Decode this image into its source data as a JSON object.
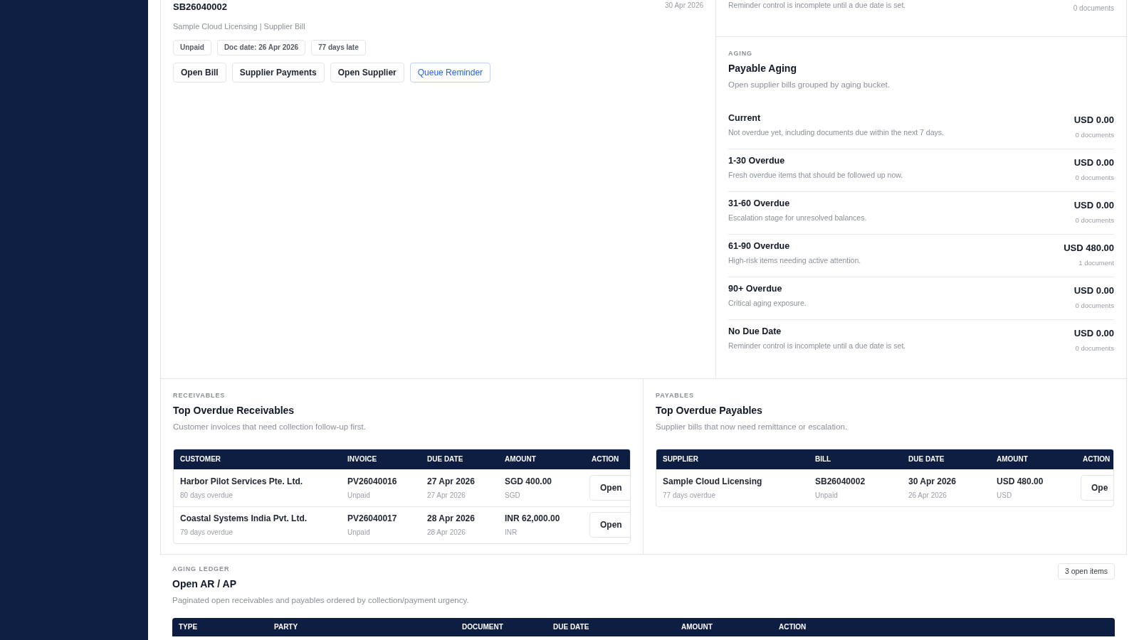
{
  "bill_card": {
    "document": "SB26040002",
    "date": "30 Apr 2026",
    "subtitle": "Sample Cloud Licensing | Supplier Bill",
    "chips": [
      "Unpaid",
      "Doc date: 26 Apr 2026",
      "77 days late"
    ],
    "actions": [
      {
        "label": "Open Bill",
        "kind": "default"
      },
      {
        "label": "Supplier Payments",
        "kind": "default"
      },
      {
        "label": "Open Supplier",
        "kind": "default"
      },
      {
        "label": "Queue Reminder",
        "kind": "primary"
      }
    ]
  },
  "previous_aging_tail": {
    "description": "Reminder control is incomplete until a due date is set.",
    "count": "0 documents"
  },
  "payable_aging": {
    "eyebrow": "AGING",
    "title": "Payable Aging",
    "description": "Open supplier bills grouped by aging bucket.",
    "buckets": [
      {
        "name": "Current",
        "description": "Not overdue yet, including documents due within the next 7 days.",
        "amount": "USD 0.00",
        "count": "0 documents"
      },
      {
        "name": "1-30 Overdue",
        "description": "Fresh overdue items that should be followed up now.",
        "amount": "USD 0.00",
        "count": "0 documents"
      },
      {
        "name": "31-60 Overdue",
        "description": "Escalation stage for unresolved balances.",
        "amount": "USD 0.00",
        "count": "0 documents"
      },
      {
        "name": "61-90 Overdue",
        "description": "High-risk items needing active attention.",
        "amount": "USD 480.00",
        "count": "1 document"
      },
      {
        "name": "90+ Overdue",
        "description": "Critical aging exposure.",
        "amount": "USD 0.00",
        "count": "0 documents"
      },
      {
        "name": "No Due Date",
        "description": "Reminder control is incomplete until a due date is set.",
        "amount": "USD 0.00",
        "count": "0 documents"
      }
    ]
  },
  "receivables": {
    "eyebrow": "RECEIVABLES",
    "title": "Top Overdue Receivables",
    "description": "Customer invoices that need collection follow-up first.",
    "columns": [
      "CUSTOMER",
      "INVOICE",
      "DUE DATE",
      "AMOUNT",
      "ACTION"
    ],
    "rows": [
      {
        "party": "Harbor Pilot Services Pte. Ltd.",
        "overdue": "80 days overdue",
        "document": "PV26040016",
        "status": "Unpaid",
        "due_date": "27 Apr 2026",
        "doc_date": "27 Apr 2026",
        "amount": "SGD 400.00",
        "currency": "SGD",
        "action": "Open"
      },
      {
        "party": "Coastal Systems India Pvt. Ltd.",
        "overdue": "79 days overdue",
        "document": "PV26040017",
        "status": "Unpaid",
        "due_date": "28 Apr 2026",
        "doc_date": "28 Apr 2026",
        "amount": "INR 62,000.00",
        "currency": "INR",
        "action": "Open"
      }
    ]
  },
  "payables": {
    "eyebrow": "PAYABLES",
    "title": "Top Overdue Payables",
    "description": "Supplier bills that now need remittance or escalation.",
    "columns": [
      "SUPPLIER",
      "BILL",
      "DUE DATE",
      "AMOUNT",
      "ACTION"
    ],
    "rows": [
      {
        "party": "Sample Cloud Licensing",
        "overdue": "77 days overdue",
        "document": "SB26040002",
        "status": "Unpaid",
        "due_date": "30 Apr 2026",
        "doc_date": "26 Apr 2026",
        "amount": "USD 480.00",
        "currency": "USD",
        "action": "Ope"
      }
    ]
  },
  "ledger": {
    "eyebrow": "AGING LEDGER",
    "title": "Open AR / AP",
    "description": "Paginated open receivables and payables ordered by collection/payment urgency.",
    "badge": "3 open items",
    "columns": [
      "TYPE",
      "PARTY",
      "DOCUMENT",
      "DUE DATE",
      "AMOUNT",
      "ACTION"
    ]
  }
}
